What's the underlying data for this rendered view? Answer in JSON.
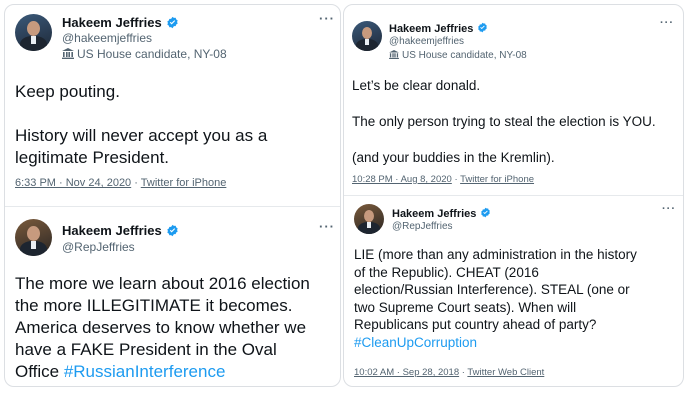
{
  "tweets": [
    {
      "name": "Hakeem Jeffries",
      "handle": "@hakeemjeffries",
      "label": "US House candidate, NY-08",
      "more": "···",
      "body": [
        "Keep pouting.",
        "",
        "History will never accept you as a",
        "legitimate President."
      ],
      "date": "6:33 PM · Nov 24, 2020",
      "sep": " · ",
      "source": "Twitter for iPhone"
    },
    {
      "name": "Hakeem Jeffries",
      "handle": "@RepJeffries",
      "more": "···",
      "body": [
        "The more we learn about 2016 election",
        "the more ILLEGITIMATE it becomes.",
        "America deserves to know whether we",
        "have a FAKE President in the Oval"
      ],
      "body_last_prefix": "Office ",
      "hashtag": "#RussianInterference"
    },
    {
      "name": "Hakeem Jeffries",
      "handle": "@hakeemjeffries",
      "label": "US House candidate, NY-08",
      "more": "···",
      "body": [
        "Let’s be clear donald.",
        "",
        "The only person trying to steal the election is YOU.",
        "",
        "(and your buddies in the Kremlin)."
      ],
      "date": "10:28 PM · Aug 8, 2020",
      "sep": " · ",
      "source": "Twitter for iPhone"
    },
    {
      "name": "Hakeem Jeffries",
      "handle": "@RepJeffries",
      "more": "···",
      "body": [
        "LIE (more than any administration in the history",
        "of the Republic). CHEAT (2016",
        "election/Russian Interference). STEAL (one or",
        "two Supreme Court seats). When will",
        "Republicans put country ahead of party?"
      ],
      "hashtag": "#CleanUpCorruption",
      "date": "10:02 AM · Sep 28, 2018",
      "sep": " · ",
      "source": "Twitter Web Client"
    }
  ],
  "colors": {
    "verified": "#1d9bf0",
    "hashtag": "#1d9bf0",
    "secondary": "#536471",
    "text": "#0f1419"
  }
}
